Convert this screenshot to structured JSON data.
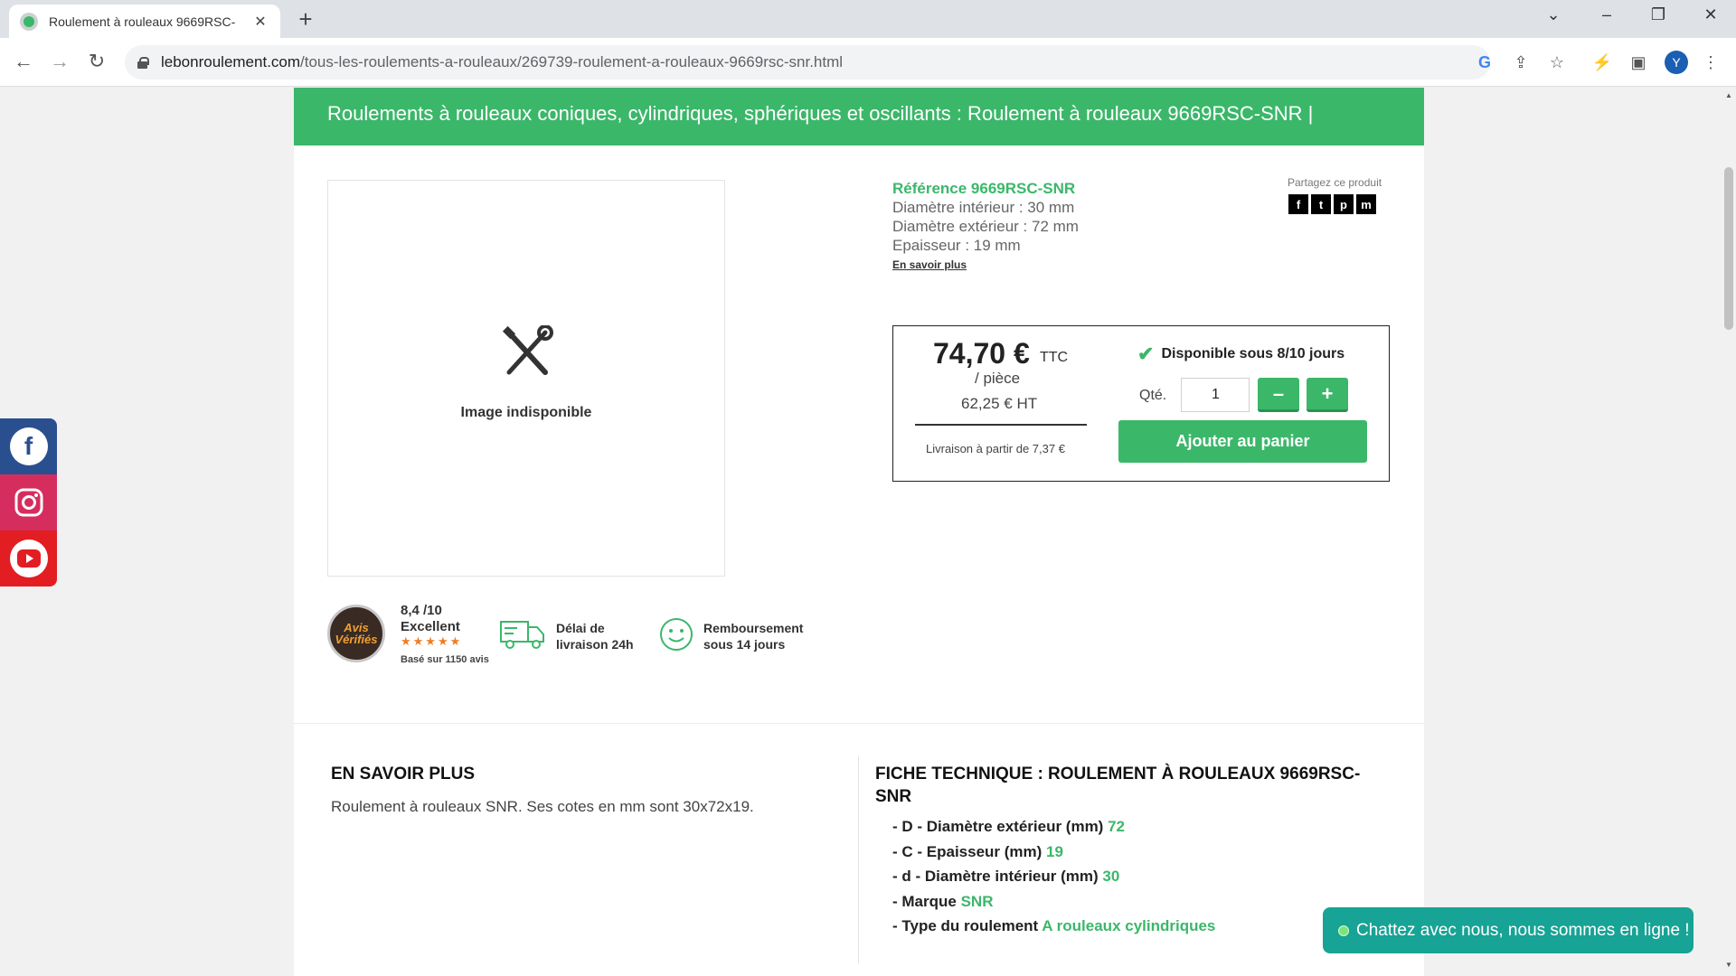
{
  "browser": {
    "tab_title": "Roulement à rouleaux 9669RSC-",
    "tab_close": "✕",
    "new_tab": "+",
    "url_domain": "lebonroulement.com",
    "url_path": "/tous-les-roulements-a-rouleaux/269739-roulement-a-rouleaux-9669rsc-snr.html",
    "profile_initial": "Y",
    "icons": [
      "tab-search-icon",
      "minimize-icon",
      "restore-icon",
      "close-icon",
      "back-icon",
      "forward-icon",
      "reload-icon",
      "google-icon",
      "share-icon",
      "star-icon",
      "extension-icon",
      "side-panel-icon",
      "menu-icon"
    ]
  },
  "banner": {
    "text": "Roulements à rouleaux coniques, cylindriques, sphériques et oscillants : Roulement à rouleaux 9669RSC-SNR |"
  },
  "product": {
    "image_caption": "Image indisponible",
    "reference": "Référence 9669RSC-SNR",
    "inner_diameter": "Diamètre intérieur : 30 mm",
    "outer_diameter": "Diamètre extérieur : 72 mm",
    "thickness": "Epaisseur : 19 mm",
    "learn_more": "En savoir plus",
    "share_label": "Partagez ce produit",
    "share_icons": [
      "f",
      "t",
      "p",
      "m"
    ]
  },
  "price": {
    "main": "74,70 €",
    "ttc": "TTC",
    "unit": "/ pièce",
    "ht": "62,25 € HT",
    "delivery": "Livraison à partir de 7,37 €",
    "availability": "Disponible sous 8/10 jours",
    "qty_label": "Qté.",
    "qty_value": "1",
    "minus": "–",
    "plus": "+",
    "add_to_cart": "Ajouter au panier"
  },
  "trust": {
    "badge_text": "Avis Vérifiés",
    "score": "8,4 /10",
    "rating_label": "Excellent",
    "stars": "★★★★★",
    "count": "Basé sur 1150 avis",
    "delivery_line1": "Délai de",
    "delivery_line2": "livraison 24h",
    "refund_line1": "Remboursement",
    "refund_line2": "sous 14 jours"
  },
  "details": {
    "learn_title": "EN SAVOIR PLUS",
    "learn_text": "Roulement à rouleaux SNR. Ses cotes en mm sont 30x72x19.",
    "tech_title_line1": "FICHE TECHNIQUE : ROULEMENT À ROULEAUX 9669RSC-",
    "tech_title_line2": "SNR",
    "specs": [
      {
        "label": "- D - Diamètre extérieur (mm)",
        "value": "72"
      },
      {
        "label": "- C - Epaisseur (mm)",
        "value": "19"
      },
      {
        "label": "- d - Diamètre intérieur (mm)",
        "value": "30"
      },
      {
        "label": "- Marque",
        "value": "SNR"
      },
      {
        "label": "- Type du roulement",
        "value": "A rouleaux cylindriques"
      }
    ]
  },
  "chat": {
    "text": "Chattez avec nous, nous sommes en ligne !"
  },
  "colors": {
    "accent": "#3bb76a",
    "chat": "#17a395",
    "facebook": "#2a4f8f",
    "instagram": "#d62d5f",
    "youtube": "#e21e23"
  }
}
